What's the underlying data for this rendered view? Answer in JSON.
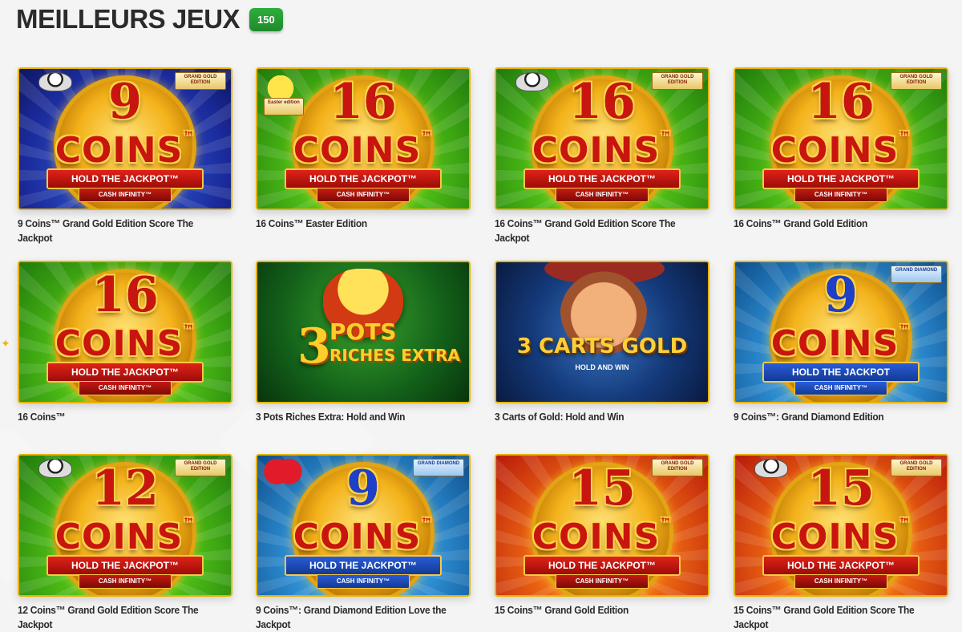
{
  "header": {
    "title": "MEILLEURS JEUX",
    "count": "150"
  },
  "games": [
    {
      "name": "9 Coins™ Grand Gold Edition Score The Jackpot",
      "art": {
        "num": "9",
        "coins": "COINS",
        "ribbon": "HOLD THE JACKPOT™",
        "sub": "CASH INFINITY™",
        "badge": "GRAND GOLD EDITION"
      }
    },
    {
      "name": "16 Coins™ Easter Edition",
      "art": {
        "num": "16",
        "coins": "COINS",
        "ribbon": "HOLD THE JACKPOT™",
        "sub": "CASH INFINITY™",
        "badge": "Easter edition"
      }
    },
    {
      "name": "16 Coins™ Grand Gold Edition Score The Jackpot",
      "art": {
        "num": "16",
        "coins": "COINS",
        "ribbon": "HOLD THE JACKPOT™",
        "sub": "CASH INFINITY™",
        "badge": "GRAND GOLD EDITION"
      }
    },
    {
      "name": "16 Coins™ Grand Gold Edition",
      "art": {
        "num": "16",
        "coins": "COINS",
        "ribbon": "HOLD THE JACKPOT™",
        "sub": "CASH INFINITY™",
        "badge": "GRAND GOLD EDITION"
      }
    },
    {
      "name": "16 Coins™",
      "art": {
        "num": "16",
        "coins": "COINS",
        "ribbon": "HOLD THE JACKPOT™",
        "sub": "CASH INFINITY™"
      }
    },
    {
      "name": "3 Pots Riches Extra: Hold and Win",
      "art": {
        "t1": "3",
        "t2": "POTS",
        "t3": "RICHES EXTRA"
      }
    },
    {
      "name": "3 Carts of Gold: Hold and Win",
      "art": {
        "t1": "3 CARTS GOLD",
        "t2": "HOLD AND WIN"
      }
    },
    {
      "name": "9 Coins™: Grand Diamond Edition",
      "art": {
        "num": "9",
        "coins": "COINS",
        "ribbon": "HOLD THE JACKPOT",
        "sub": "CASH INFINITY™",
        "badge": "GRAND DIAMOND"
      }
    },
    {
      "name": "12 Coins™ Grand Gold Edition Score The Jackpot",
      "art": {
        "num": "12",
        "coins": "COINS",
        "ribbon": "HOLD THE JACKPOT™",
        "sub": "CASH INFINITY™",
        "badge": "GRAND GOLD EDITION"
      }
    },
    {
      "name": "9 Coins™: Grand Diamond Edition Love the Jackpot",
      "art": {
        "num": "9",
        "coins": "COINS",
        "ribbon": "HOLD THE JACKPOT™",
        "sub": "CASH INFINITY™",
        "badge": "GRAND DIAMOND"
      }
    },
    {
      "name": "15 Coins™ Grand Gold Edition",
      "art": {
        "num": "15",
        "coins": "COINS",
        "ribbon": "HOLD THE JACKPOT™",
        "sub": "CASH INFINITY™",
        "badge": "GRAND GOLD EDITION"
      }
    },
    {
      "name": "15 Coins™ Grand Gold Edition Score The Jackpot",
      "art": {
        "num": "15",
        "coins": "COINS",
        "ribbon": "HOLD THE JACKPOT™",
        "sub": "CASH INFINITY™",
        "badge": "GRAND GOLD EDITION"
      }
    }
  ],
  "colors": {
    "accent_badge": "#2fae3e",
    "thumb_border": "#e6b400",
    "text": "#2b2b2b"
  }
}
